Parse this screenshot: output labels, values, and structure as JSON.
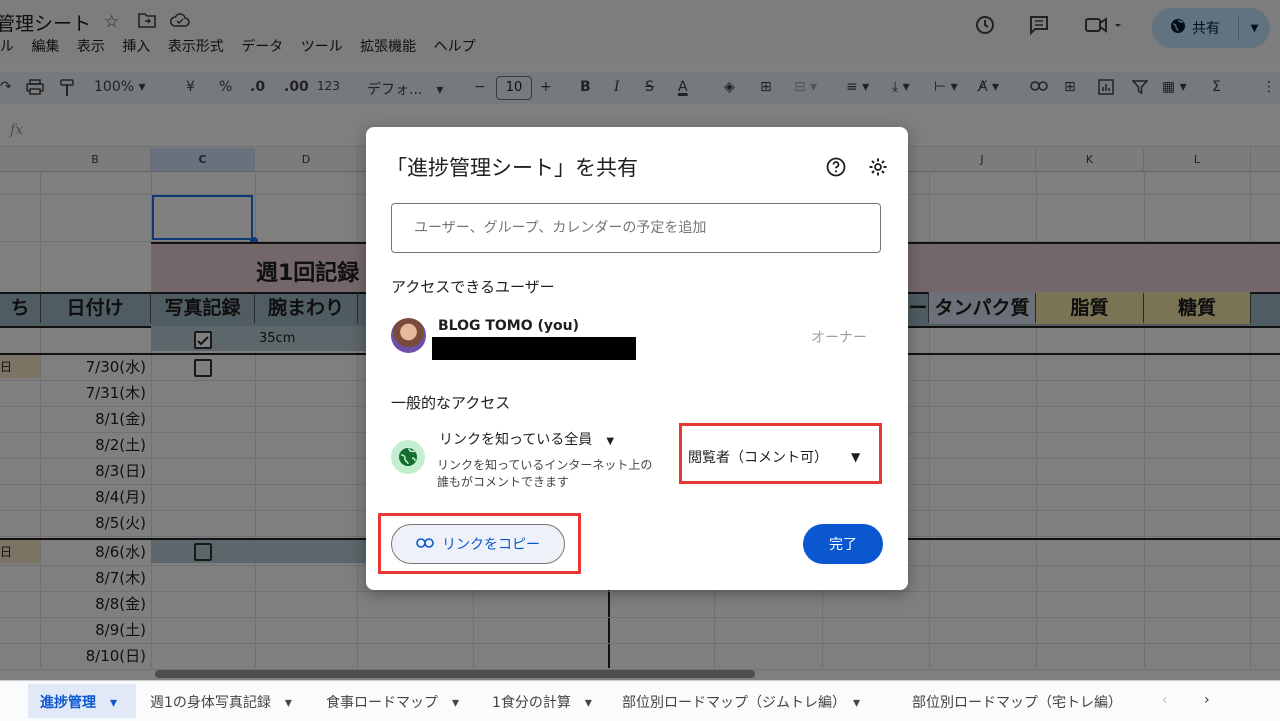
{
  "app": {
    "title": "管理シート",
    "menu": [
      "ル",
      "編集",
      "表示",
      "挿入",
      "表示形式",
      "データ",
      "ツール",
      "拡張機能",
      "ヘルプ"
    ],
    "share_label": "共有"
  },
  "toolbar": {
    "zoom": "100%",
    "currency": "¥",
    "percent": "%",
    "dec_decrease": ".0",
    "dec_increase": ".00",
    "number_format": "123",
    "font": "デフォ...",
    "font_size": "10",
    "bold": "B",
    "italic": "I"
  },
  "formula_bar": {
    "fx": "fx"
  },
  "columns": [
    "B",
    "C",
    "D",
    "J",
    "K",
    "L"
  ],
  "sheet": {
    "banner": "週1回記録",
    "headers": {
      "left": "ち",
      "date": "日付け",
      "photo": "写真記録",
      "arm": "腕まわり",
      "dash": "ー",
      "protein": "タンパク質",
      "fat": "脂質",
      "carb": "糖質"
    },
    "first_row_value": "35cm",
    "day_marker": "日",
    "dates": [
      "7/30(水)",
      "7/31(木)",
      "8/1(金)",
      "8/2(土)",
      "8/3(日)",
      "8/4(月)",
      "8/5(火)",
      "8/6(水)",
      "8/7(木)",
      "8/8(金)",
      "8/9(土)",
      "8/10(日)"
    ]
  },
  "dialog": {
    "title": "「進捗管理シート」を共有",
    "add_placeholder": "ユーザー、グループ、カレンダーの予定を追加",
    "people_heading": "アクセスできるユーザー",
    "user_name": "BLOG TOMO (you)",
    "user_role": "オーナー",
    "general_heading": "一般的なアクセス",
    "link_scope": "リンクを知っている全員",
    "link_description_1": "リンクを知っているインターネット上の",
    "link_description_2": "誰もがコメントできます",
    "role_select": "閲覧者（コメント可）",
    "copy_link": "リンクをコピー",
    "done": "完了"
  },
  "tabs": [
    "進捗管理",
    "週1の身体写真記録",
    "食事ロードマップ",
    "1食分の計算",
    "部位別ロードマップ（ジムトレ編）",
    "部位別ロードマップ（宅トレ編）"
  ],
  "colors": {
    "accent": "#0b57d0",
    "share_bg": "#c2e7ff",
    "highlight_red": "#e53935",
    "globe_bg": "#c4eed0"
  }
}
